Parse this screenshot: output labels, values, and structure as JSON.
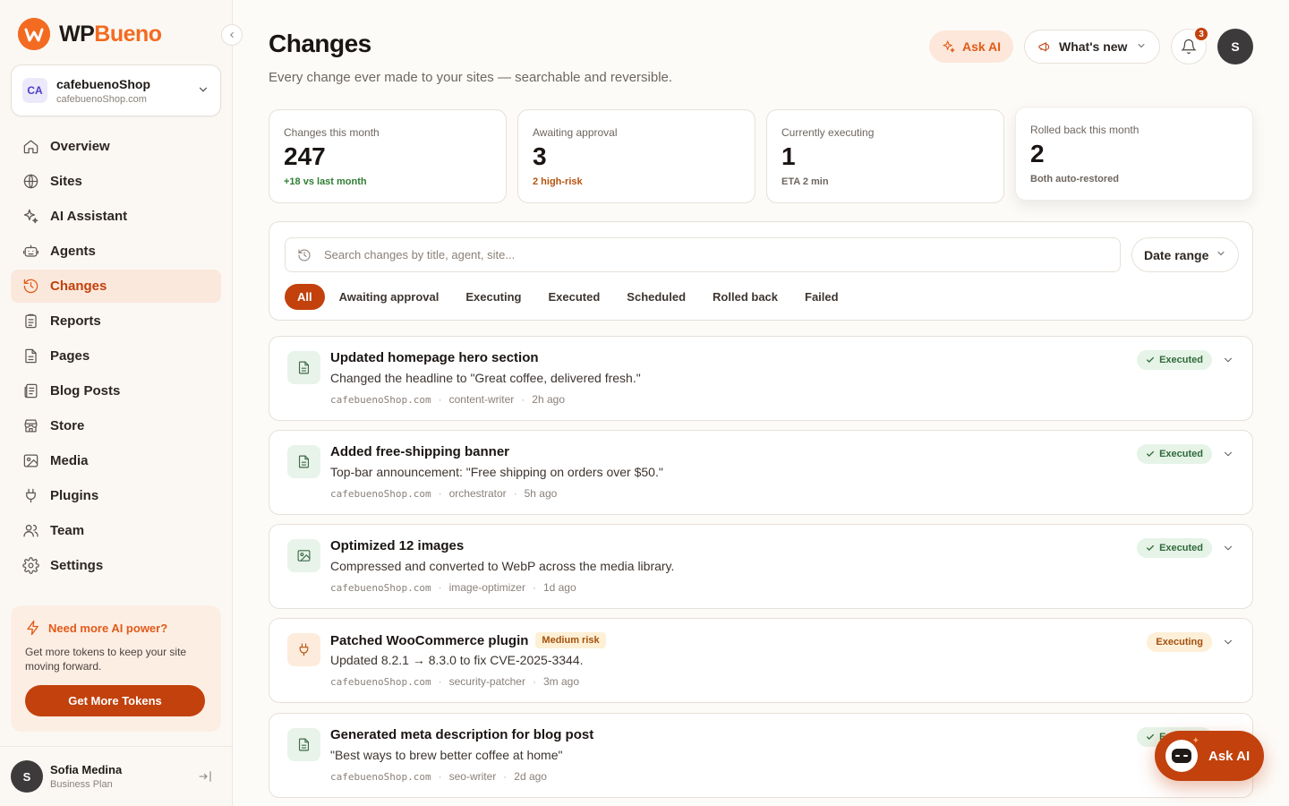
{
  "brand": {
    "wp": "WP",
    "bueno": "Bueno",
    "logo_icon": "wpbueno-logo"
  },
  "site_switcher": {
    "initials": "CA",
    "name": "cafebuenoShop",
    "domain": "cafebuenoShop.com"
  },
  "nav": [
    {
      "label": "Overview",
      "icon": "home-icon",
      "active": false
    },
    {
      "label": "Sites",
      "icon": "globe-icon",
      "active": false
    },
    {
      "label": "AI Assistant",
      "icon": "sparkles-icon",
      "active": false
    },
    {
      "label": "Agents",
      "icon": "robot-icon",
      "active": false
    },
    {
      "label": "Changes",
      "icon": "history-icon",
      "active": true
    },
    {
      "label": "Reports",
      "icon": "clipboard-icon",
      "active": false
    },
    {
      "label": "Pages",
      "icon": "file-icon",
      "active": false
    },
    {
      "label": "Blog Posts",
      "icon": "newspaper-icon",
      "active": false
    },
    {
      "label": "Store",
      "icon": "store-icon",
      "active": false
    },
    {
      "label": "Media",
      "icon": "image-icon",
      "active": false
    },
    {
      "label": "Plugins",
      "icon": "plug-icon",
      "active": false
    },
    {
      "label": "Team",
      "icon": "users-icon",
      "active": false
    },
    {
      "label": "Settings",
      "icon": "gear-icon",
      "active": false
    }
  ],
  "promo": {
    "title": "Need more AI power?",
    "text": "Get more tokens to keep your site moving forward.",
    "button": "Get More Tokens"
  },
  "user": {
    "initial": "S",
    "name": "Sofia Medina",
    "plan": "Business Plan"
  },
  "header": {
    "title": "Changes",
    "subtitle": "Every change ever made to your sites — searchable and reversible.",
    "ask_ai": "Ask AI",
    "whats_new": "What's new",
    "notifications_count": "3",
    "avatar_initial": "S"
  },
  "stats": [
    {
      "label": "Changes this month",
      "value": "247",
      "note": "+18 vs last month",
      "note_color": "#2f7d32"
    },
    {
      "label": "Awaiting approval",
      "value": "3",
      "note": "2 high-risk",
      "note_color": "#b5530f"
    },
    {
      "label": "Currently executing",
      "value": "1",
      "note": "ETA 2 min",
      "note_color": "#6e665f"
    },
    {
      "label": "Rolled back this month",
      "value": "2",
      "note": "Both auto-restored",
      "note_color": "#6e665f"
    }
  ],
  "filters": {
    "search_placeholder": "Search changes by title, agent, site...",
    "search_value": "",
    "date_range": "Date range",
    "tabs": [
      "All",
      "Awaiting approval",
      "Executing",
      "Executed",
      "Scheduled",
      "Rolled back",
      "Failed"
    ],
    "active_tab": "All"
  },
  "changes": [
    {
      "title": "Updated homepage hero section",
      "risk": "",
      "desc": "Changed the headline to \"Great coffee, delivered fresh.\"",
      "site": "cafebuenoShop.com",
      "agent": "content-writer",
      "time": "2h ago",
      "status": "Executed",
      "icon": "document-icon",
      "tone": "green"
    },
    {
      "title": "Added free-shipping banner",
      "risk": "",
      "desc": "Top-bar announcement: \"Free shipping on orders over $50.\"",
      "site": "cafebuenoShop.com",
      "agent": "orchestrator",
      "time": "5h ago",
      "status": "Executed",
      "icon": "document-icon",
      "tone": "green"
    },
    {
      "title": "Optimized 12 images",
      "risk": "",
      "desc": "Compressed and converted to WebP across the media library.",
      "site": "cafebuenoShop.com",
      "agent": "image-optimizer",
      "time": "1d ago",
      "status": "Executed",
      "icon": "image-icon",
      "tone": "green"
    },
    {
      "title": "Patched WooCommerce plugin",
      "risk": "Medium risk",
      "desc": "Updated 8.2.1 → 8.3.0 to fix CVE-2025-3344.",
      "site": "cafebuenoShop.com",
      "agent": "security-patcher",
      "time": "3m ago",
      "status": "Executing",
      "icon": "plug-icon",
      "tone": "orange"
    },
    {
      "title": "Generated meta description for blog post",
      "risk": "",
      "desc": "\"Best ways to brew better coffee at home\"",
      "site": "cafebuenoShop.com",
      "agent": "seo-writer",
      "time": "2d ago",
      "status": "Executed",
      "icon": "document-icon",
      "tone": "green"
    }
  ],
  "fab": {
    "label": "Ask AI",
    "icon": "robot-icon"
  }
}
